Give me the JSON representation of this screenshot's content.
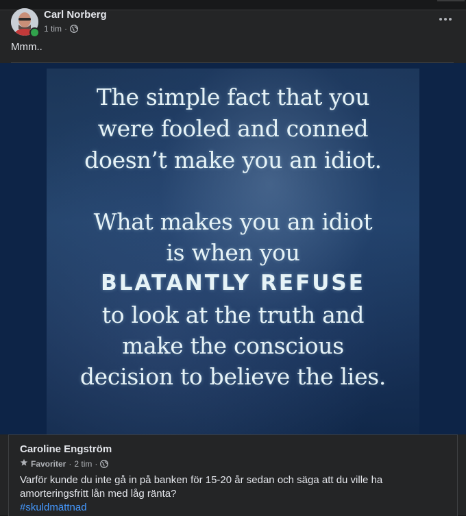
{
  "post": {
    "author": "Carl Norberg",
    "time": "1 tim",
    "separator": "·",
    "text": "Mmm..",
    "image_quote": {
      "line1": "The simple fact that you",
      "line2": "were fooled and conned",
      "line3": "doesn’t make you an idiot.",
      "line4": "What makes you an idiot",
      "line5": "is when you",
      "line6": "BLATANTLY REFUSE",
      "line7": "to look at the truth and",
      "line8": "make the conscious",
      "line9": "decision to believe the lies."
    }
  },
  "comment": {
    "author": "Caroline Engström",
    "badge": "Favoriter",
    "time": "2 tim",
    "separator": "·",
    "text": "Varför kunde du inte gå in på banken för 15-20 år sedan och säga att du ville ha amorteringsfritt lån med låg ränta?",
    "hashtag": "#skuldmättnad"
  },
  "colors": {
    "background": "#242526",
    "text": "#e4e6eb",
    "secondary_text": "#b0b3b8",
    "link": "#4599ff",
    "online": "#31a24c"
  },
  "icons": [
    "globe-icon",
    "more-options-icon",
    "star-icon"
  ]
}
